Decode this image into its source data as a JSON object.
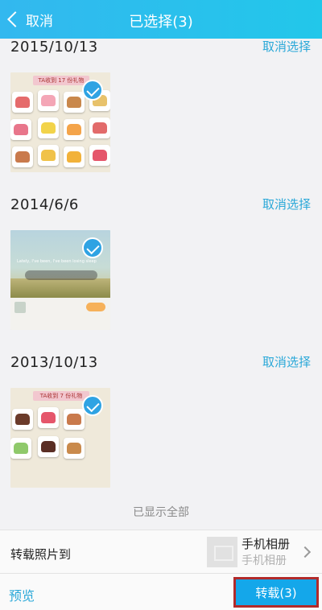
{
  "header": {
    "back_label": "取消",
    "title": "已选择(3)"
  },
  "groups": [
    {
      "date": "2015/10/13",
      "cancel_label": "取消选择",
      "banner": "TA收到 17 份礼物"
    },
    {
      "date": "2014/6/6",
      "cancel_label": "取消选择",
      "overlay": "Lately, I've been, I've been losing sleep"
    },
    {
      "date": "2013/10/13",
      "cancel_label": "取消选择",
      "banner": "TA收到 7 份礼物"
    }
  ],
  "footer_note": "已显示全部",
  "save_to": {
    "label": "转载照片到",
    "album_name": "手机相册",
    "album_sub": "手机相册"
  },
  "bottom": {
    "preview_label": "预览",
    "submit_label": "转载(3)"
  },
  "colors": {
    "header": "#22c7ea",
    "accent": "#2aa8d8",
    "submit": "#14a7ea"
  }
}
